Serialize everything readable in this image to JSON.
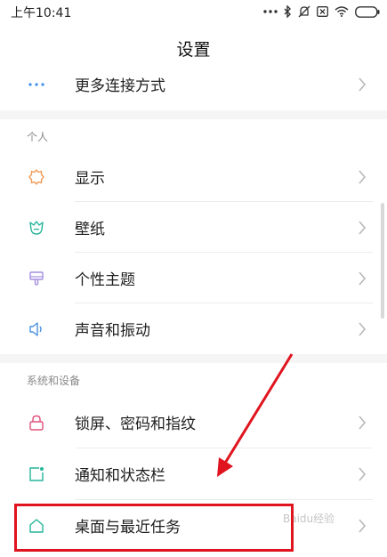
{
  "status_bar": {
    "time": "上午10:41"
  },
  "header": {
    "title": "设置"
  },
  "rows": {
    "more_connections": {
      "label": "更多连接方式",
      "icon": "more-dots-icon"
    },
    "display": {
      "label": "显示",
      "icon": "sun-icon"
    },
    "wallpaper": {
      "label": "壁纸",
      "icon": "tulip-icon"
    },
    "theme": {
      "label": "个性主题",
      "icon": "brush-icon"
    },
    "sound": {
      "label": "声音和振动",
      "icon": "speaker-icon"
    },
    "lockscreen": {
      "label": "锁屏、密码和指纹",
      "icon": "lock-icon"
    },
    "notifications": {
      "label": "通知和状态栏",
      "icon": "notification-icon"
    },
    "home": {
      "label": "桌面与最近任务",
      "icon": "home-icon"
    }
  },
  "sections": {
    "personal": "个人",
    "system": "系统和设备"
  },
  "watermark": "Baidu经验",
  "colors": {
    "accent_teal": "#25b49a",
    "sun_orange": "#f09a56",
    "brush_purple": "#a48ee0",
    "speaker_blue": "#4a90e2",
    "lock_pink": "#e0507a",
    "more_blue": "#3b8ef0",
    "annotation_red": "#e0141e"
  }
}
